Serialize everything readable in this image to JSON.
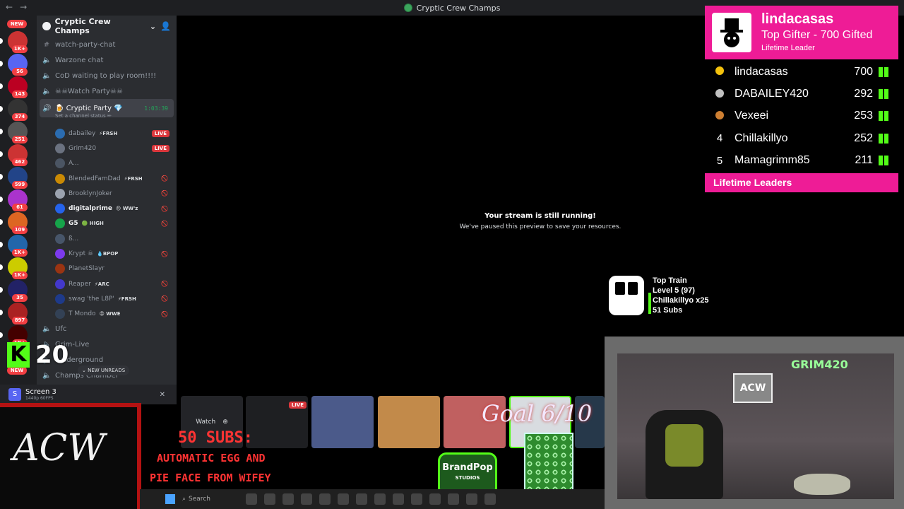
{
  "window": {
    "title": "Cryptic Crew Champs"
  },
  "rail": {
    "new_top": "NEW",
    "badges": [
      "1K+",
      "56",
      "143",
      "374",
      "251",
      "462",
      "599",
      "61",
      "109",
      "1K+",
      "1K+",
      "35",
      "897",
      "1K+"
    ],
    "new_bottom": "NEW"
  },
  "server": {
    "name": "Cryptic Crew Champs",
    "channels": [
      {
        "type": "text",
        "name": "watch-party-chat"
      },
      {
        "type": "voice",
        "name": "Warzone chat"
      },
      {
        "type": "voice",
        "name": "CoD waiting to play room!!!!"
      },
      {
        "type": "voice",
        "name": "☠☠Watch Party☠☠"
      }
    ],
    "active_channel": {
      "name": "🍺 Cryptic Party 💎",
      "timer": "1:03:39",
      "status": "Set a channel status ✏"
    },
    "users": [
      {
        "name": "dabailey",
        "tag": "⚡FRSH",
        "live": "LIVE",
        "bold": false
      },
      {
        "name": "Grim420",
        "tag": "",
        "live": "LIVE",
        "bold": false
      },
      {
        "name": "A...",
        "tag": "",
        "live": "",
        "bold": false
      },
      {
        "name": "BlendedFamDad",
        "tag": "⚡FRSH",
        "live": "",
        "bold": false
      },
      {
        "name": "BrooklynJoker",
        "tag": "",
        "live": "",
        "bold": false
      },
      {
        "name": "digitalprime",
        "tag": "😠 WW'z",
        "live": "",
        "bold": true
      },
      {
        "name": "G5",
        "tag": "🟢 HIGH",
        "live": "",
        "bold": true
      },
      {
        "name": "ß...",
        "tag": "",
        "live": "",
        "bold": false
      },
      {
        "name": "Krypt ☠",
        "tag": "💧BPOP",
        "live": "",
        "bold": false
      },
      {
        "name": "PlanetSlayr",
        "tag": "",
        "live": "",
        "bold": false
      },
      {
        "name": "Reaper",
        "tag": "⚡ARC",
        "live": "",
        "bold": false
      },
      {
        "name": "swag 'the L8P'",
        "tag": "⚡FRSH",
        "live": "",
        "bold": false
      },
      {
        "name": "T Mondo",
        "tag": "😡 WWE",
        "live": "",
        "bold": false
      }
    ],
    "more_channels": [
      {
        "type": "voice",
        "name": "Ufc"
      },
      {
        "type": "voice",
        "name": "Grim-Live"
      },
      {
        "type": "voice",
        "name": "-underground"
      },
      {
        "type": "voice",
        "name": "Champs Chamber"
      }
    ],
    "new_unreads": "⌄ NEW UNREADS"
  },
  "voice_panel": {
    "title": "Screen 3",
    "sub": "1440p 60FPS"
  },
  "overlay_count": "20",
  "preview": {
    "line1": "Your stream is still running!",
    "line2": "We've paused this preview to save your resources."
  },
  "gifter": {
    "name": "lindacasas",
    "line2": "Top Gifter - 700 Gifted",
    "line3": "Lifetime Leader"
  },
  "leaderboard": [
    {
      "rank": "",
      "name": "lindacasas",
      "value": "700",
      "medal": "#f4c20d"
    },
    {
      "rank": "",
      "name": "DABAILEY420",
      "value": "292",
      "medal": "#c0c0c0"
    },
    {
      "rank": "",
      "name": "Vexeei",
      "value": "253",
      "medal": "#cd7f32"
    },
    {
      "rank": "4",
      "name": "Chillakillyo",
      "value": "252",
      "medal": ""
    },
    {
      "rank": "5",
      "name": "Mamagrimm85",
      "value": "211",
      "medal": ""
    }
  ],
  "leaders_label": "Lifetime Leaders",
  "train": {
    "title": "Top Train",
    "level": "Level 5 (97)",
    "user": "Chillakillyo x25",
    "subs": "51 Subs"
  },
  "tiles": {
    "watch": "Watch",
    "live": "LIVE"
  },
  "goal": "Goal 6/10",
  "subs_text": {
    "a": "50 SUBS:",
    "b": "AUTOMATIC EGG AND",
    "c": "PIE FACE FROM WIFEY"
  },
  "brandpop": {
    "main": "BrandPop",
    "sub": "STUDIOS"
  },
  "acw": "ACW",
  "taskbar": {
    "search": "Search"
  },
  "colors": {
    "accent_pink": "#ee1c96",
    "kick_green": "#53fc18",
    "live_red": "#da373c"
  }
}
